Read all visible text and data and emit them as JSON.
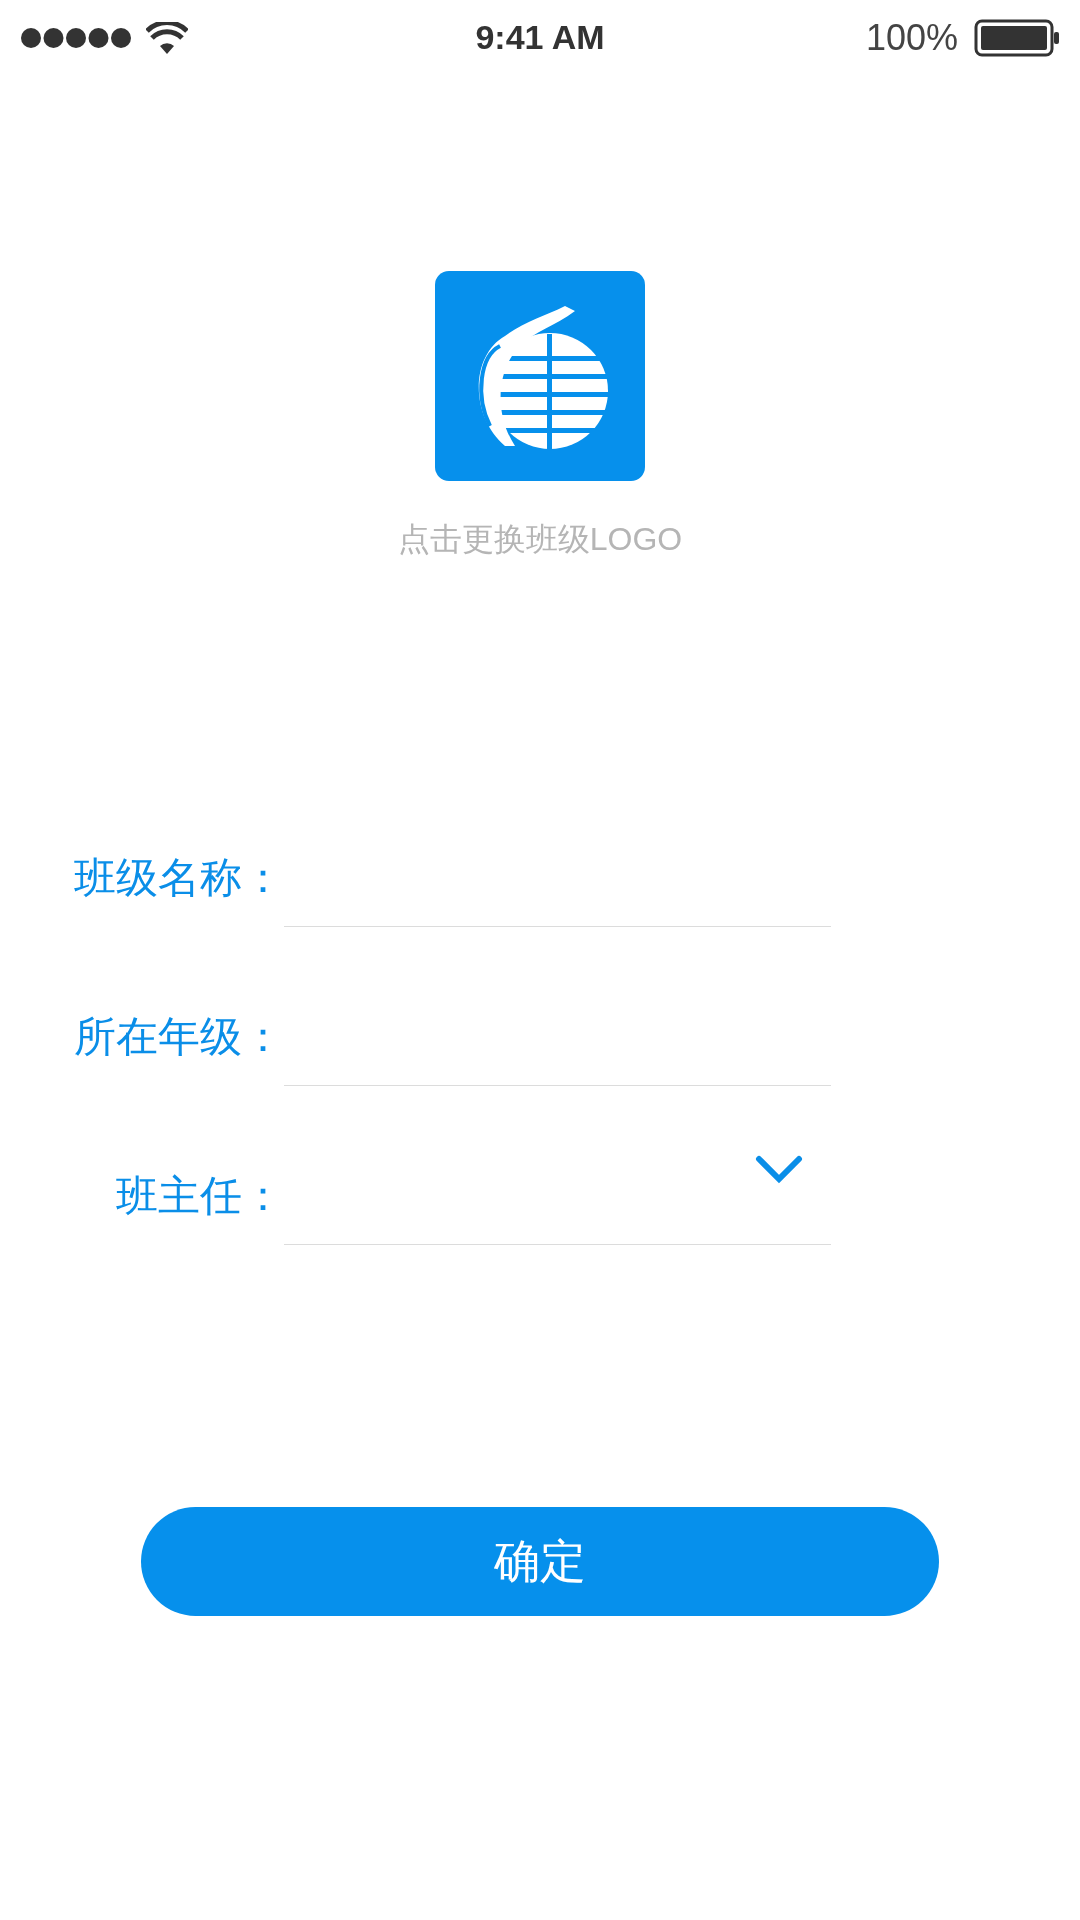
{
  "status_bar": {
    "time": "9:41 AM",
    "battery": "100%"
  },
  "logo": {
    "caption": "点击更换班级LOGO"
  },
  "fields": [
    {
      "kind": "text",
      "label": "班级名称："
    },
    {
      "kind": "text",
      "label": "所在年级："
    },
    {
      "kind": "select",
      "label": "班主任："
    }
  ],
  "confirm_button": "确定"
}
